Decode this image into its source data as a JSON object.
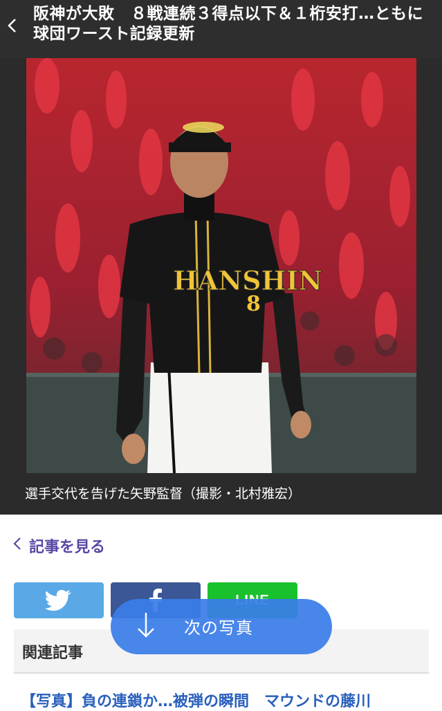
{
  "header": {
    "back_icon": "chevron-left-icon",
    "title": "阪神が大敗　８戦連続３得点以下＆１桁安打…ともに球団ワースト記録更新"
  },
  "photo": {
    "jersey_text": "HANSHIN",
    "jersey_number": "8"
  },
  "caption": "選手交代を告げた矢野監督（撮影・北村雅宏）",
  "view_article": {
    "icon": "chevron-left-icon",
    "label": "記事を見る"
  },
  "share": {
    "twitter_icon": "twitter-bird-icon",
    "facebook_icon": "facebook-f-icon",
    "line_label": "LINE"
  },
  "related": {
    "label": "関連記事",
    "first_item": "【写真】負の連鎖か…被弾の瞬間　マウンドの藤川"
  },
  "next_photo": {
    "icon": "arrow-down-icon",
    "label": "次の写真"
  },
  "colors": {
    "header_bg": "#2e2e2e",
    "accent_purple": "#5a47a6",
    "twitter": "#5aa9e6",
    "facebook": "#3b5795",
    "line": "#19c12c",
    "next_button": "#3a7de8",
    "link": "#2a5fbd"
  }
}
